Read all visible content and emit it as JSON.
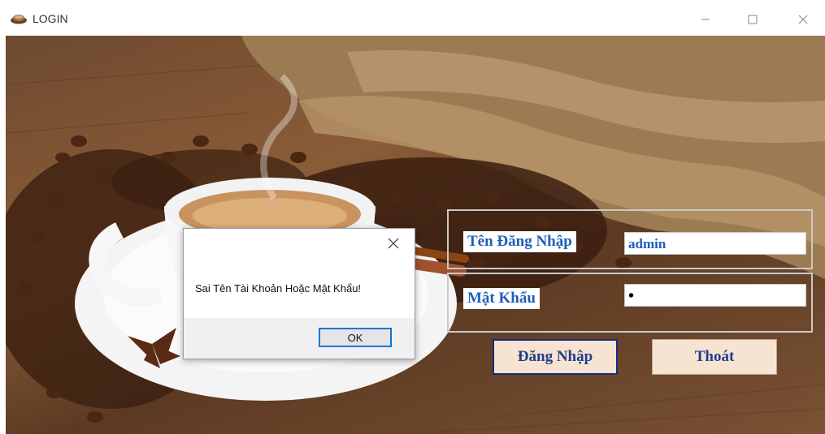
{
  "window": {
    "title": "LOGIN",
    "icon": "coffee-cup-icon",
    "controls": [
      "minimize-icon",
      "maximize-icon",
      "close-icon"
    ]
  },
  "form": {
    "username_label": "Tên Đăng Nhập",
    "username_value": "admin",
    "password_label": "Mật Khẩu",
    "password_value": "•",
    "login_button": "Đăng Nhập",
    "exit_button": "Thoát"
  },
  "dialog": {
    "message": "Sai Tên Tài Khoản Hoặc Mật Khẩu!",
    "ok_button": "OK"
  },
  "colors": {
    "label_text": "#1f5fb8",
    "button_bg": "#f7e3d2",
    "login_border": "#1a2b7a",
    "ok_border": "#0078d7"
  }
}
